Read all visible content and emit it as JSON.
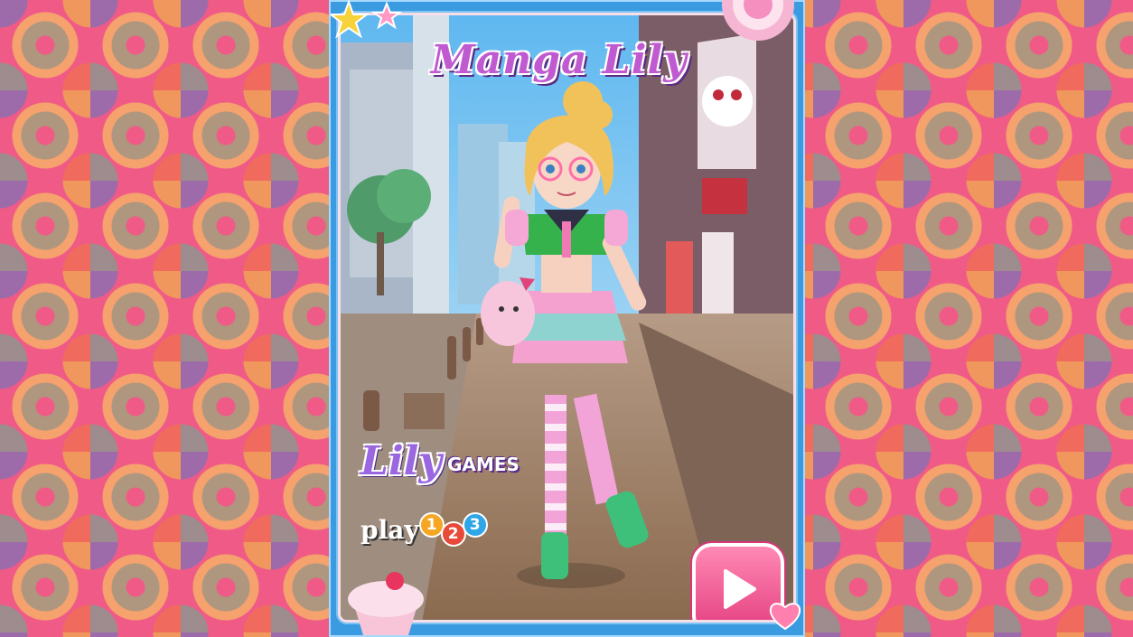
{
  "game": {
    "title": "Manga Lily",
    "publisher_logo": {
      "lily": "Lily",
      "games": "GAMES"
    },
    "sponsor_logo": {
      "word": "play",
      "digits": [
        "1",
        "2",
        "3"
      ]
    },
    "play_button": {
      "icon": "play-triangle-icon"
    }
  },
  "colors": {
    "frame_blue": "#3b9be0",
    "title_purple": "#c05ad0",
    "play_button_pink": "#e43f80"
  },
  "icons": [
    "play-triangle-icon",
    "cupcake-icon",
    "lollipop-icon",
    "star-icon",
    "heart-icon"
  ]
}
